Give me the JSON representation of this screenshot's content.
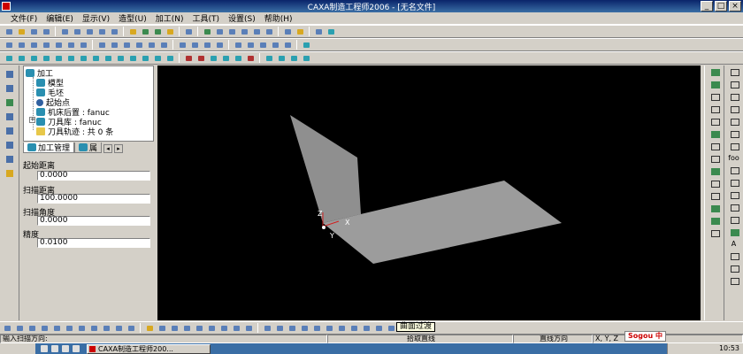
{
  "window": {
    "title": "CAXA制造工程师2006 - [无名文件]",
    "controls": [
      "_",
      "□",
      "×"
    ]
  },
  "menu": [
    "文件(F)",
    "编辑(E)",
    "显示(V)",
    "造型(U)",
    "加工(N)",
    "工具(T)",
    "设置(S)",
    "帮助(H)"
  ],
  "tree": {
    "root": "加工",
    "model": "模型",
    "stock": "毛坯",
    "start_point": "起始点",
    "post": "机床后置 : fanuc",
    "tool_lib": "刀具库 : fanuc",
    "toolpath": "刀具轨迹 : 共 0 条"
  },
  "tabs": {
    "machining": "加工管理",
    "attr": "属"
  },
  "params": [
    {
      "label": "起始距离",
      "value": "0.0000"
    },
    {
      "label": "扫描距离",
      "value": "100.0000"
    },
    {
      "label": "扫描角度",
      "value": "0.0000"
    },
    {
      "label": "精度",
      "value": "0.0100"
    }
  ],
  "viewport": {
    "axis_x": "X",
    "axis_y": "Y",
    "axis_z": "Z",
    "background": "#000000",
    "surface_color": "#9a9a9a"
  },
  "tooltip": "曲面过渡",
  "status": {
    "prompt": "输入扫描方向:",
    "command": "拾取直线",
    "mode": "直线方向",
    "coords": "X, Y, Z"
  },
  "right_labels": {
    "foo": "foo",
    "A": "A"
  },
  "taskbar": {
    "start": "",
    "task": "CAXA制造工程师200...",
    "ime": "Sogou 中",
    "time": "10:53"
  }
}
